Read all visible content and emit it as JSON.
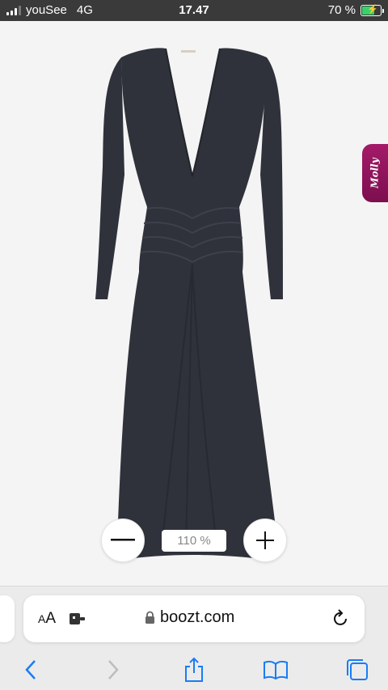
{
  "status_bar": {
    "carrier": "youSee",
    "network": "4G",
    "time": "17.47",
    "battery_percent": "70 %",
    "battery_level": 0.7
  },
  "product": {
    "image_icon": "dress-photo",
    "side_tab_label": "Molly",
    "zoom_level": "110 %",
    "zoom_out_icon": "minus-icon",
    "zoom_in_icon": "plus-icon"
  },
  "browser": {
    "text_size_label_small": "A",
    "text_size_label_large": "A",
    "url": "boozt.com",
    "icons": [
      "extension-icon",
      "lock-icon",
      "reload-icon",
      "back-arrow-icon",
      "forward-arrow-icon",
      "share-icon",
      "bookmarks-icon",
      "tabs-icon"
    ]
  },
  "colors": {
    "status_bar_bg": "#3a3a3a",
    "page_bg": "#f4f4f4",
    "dress": "#2f323b",
    "side_tab": "#8f1460",
    "accent_blue": "#1a7cf5",
    "battery_green": "#3ad16a"
  }
}
